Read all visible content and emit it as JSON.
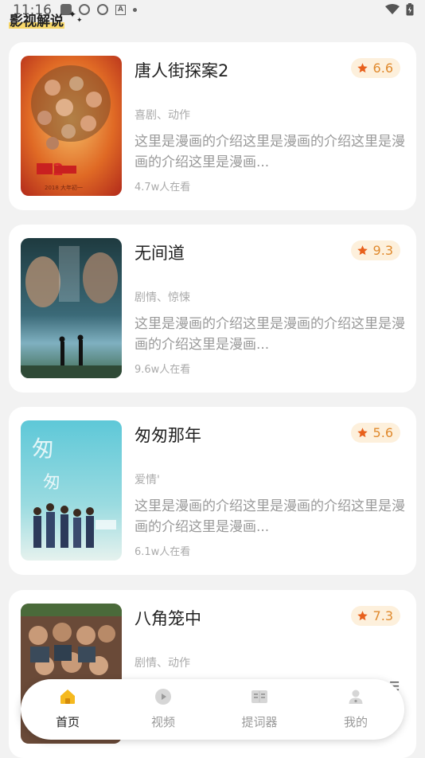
{
  "status_bar": {
    "time": "11:16"
  },
  "header": {
    "title": "影视解说"
  },
  "movies": [
    {
      "title": "唐人街探案2",
      "rating": "6.6",
      "genre": "喜剧、动作",
      "description": "这里是漫画的介绍这里是漫画的介绍这里是漫画的介绍这里是漫画...",
      "views": "4.7w人在看"
    },
    {
      "title": "无间道",
      "rating": "9.3",
      "genre": "剧情、惊悚",
      "description": "这里是漫画的介绍这里是漫画的介绍这里是漫画的介绍这里是漫画...",
      "views": "9.6w人在看"
    },
    {
      "title": "匆匆那年",
      "rating": "5.6",
      "genre": "爱情'",
      "description": "这里是漫画的介绍这里是漫画的介绍这里是漫画的介绍这里是漫画...",
      "views": "6.1w人在看"
    },
    {
      "title": "八角笼中",
      "rating": "7.3",
      "genre": "剧情、动作",
      "description": "",
      "views": ""
    }
  ],
  "bottom_nav": {
    "items": [
      {
        "label": "首页",
        "icon": "home-icon",
        "active": true
      },
      {
        "label": "视频",
        "icon": "play-icon",
        "active": false
      },
      {
        "label": "提词器",
        "icon": "book-icon",
        "active": false
      },
      {
        "label": "我的",
        "icon": "user-icon",
        "active": false
      }
    ]
  },
  "colors": {
    "accent": "#f5a623",
    "rating_text": "#e08a2e",
    "rating_bg": "#fdf0dc",
    "header_highlight": "#f8d86a",
    "star": "#e8601c"
  }
}
